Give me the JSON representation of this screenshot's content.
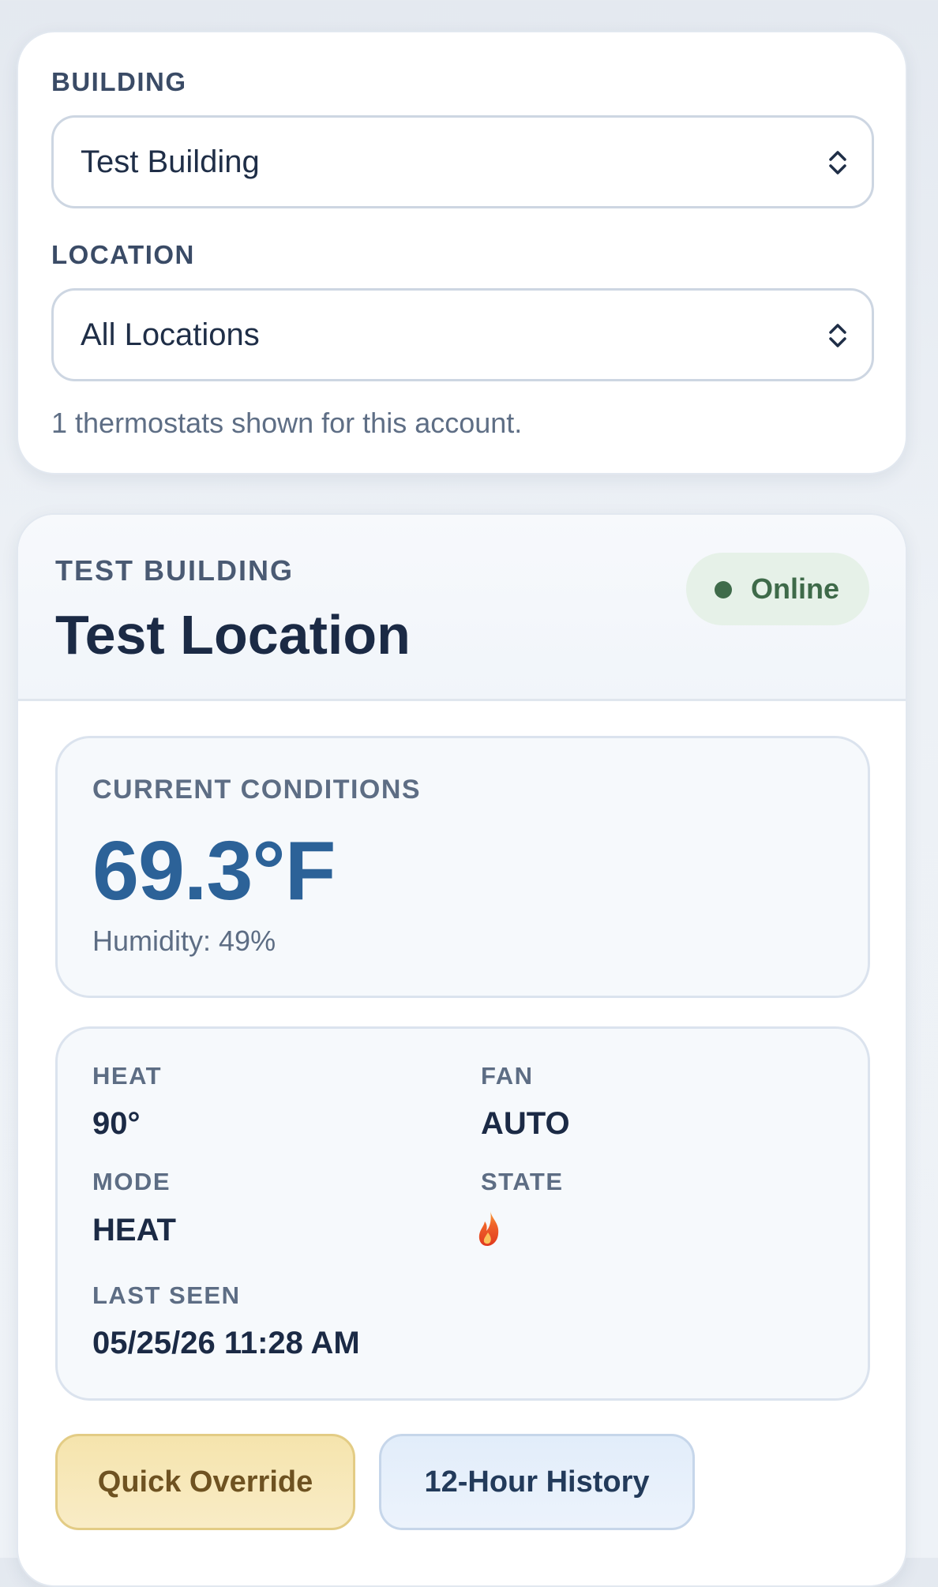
{
  "filters": {
    "building_label": "BUILDING",
    "building_value": "Test Building",
    "location_label": "LOCATION",
    "location_value": "All Locations",
    "summary": "1 thermostats shown for this account."
  },
  "thermostat": {
    "building": "TEST BUILDING",
    "location": "Test Location",
    "status": "Online",
    "conditions": {
      "label": "CURRENT CONDITIONS",
      "temperature": "69.3°F",
      "humidity": "Humidity: 49%"
    },
    "details": {
      "heat_label": "HEAT",
      "heat_value": "90°",
      "fan_label": "FAN",
      "fan_value": "AUTO",
      "mode_label": "MODE",
      "mode_value": "HEAT",
      "state_label": "STATE",
      "state_icon": "flame-icon",
      "last_seen_label": "LAST SEEN",
      "last_seen_value": "05/25/26 11:28 AM"
    },
    "actions": {
      "override": "Quick Override",
      "history": "12-Hour History"
    }
  },
  "colors": {
    "status_bg": "#e6f1e8",
    "status_text": "#3e6a49",
    "temperature": "#2c6298",
    "override_bg": "#f5e4ad",
    "history_bg": "#e2edfa"
  }
}
